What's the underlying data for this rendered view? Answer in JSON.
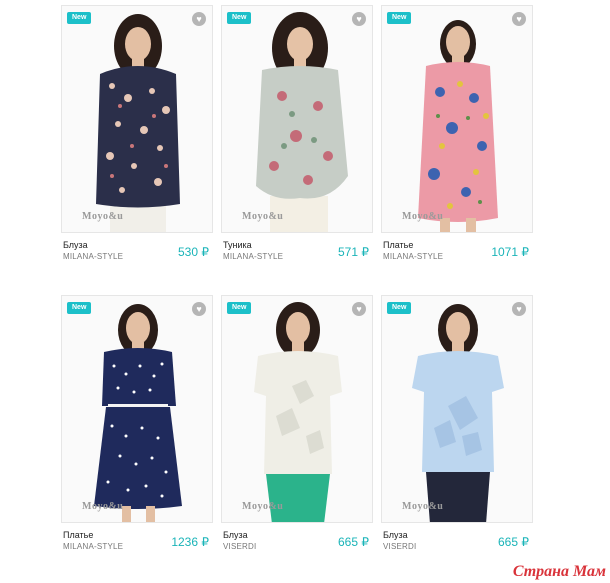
{
  "badge_label": "New",
  "favorite_icon": "heart-icon",
  "watermark_text": "Moyo&u",
  "site_logo": "Страна Мам",
  "colors": {
    "accent": "#1cc0c9",
    "price": "#1ab4b8",
    "logo": "#d9333a"
  },
  "products": [
    {
      "type": "Блуза",
      "brand": "MILANA-STYLE",
      "price": "530 ₽"
    },
    {
      "type": "Туника",
      "brand": "MILANA-STYLE",
      "price": "571 ₽"
    },
    {
      "type": "Платье",
      "brand": "MILANA-STYLE",
      "price": "1071 ₽"
    },
    {
      "type": "Платье",
      "brand": "MILANA-STYLE",
      "price": "1236 ₽"
    },
    {
      "type": "Блуза",
      "brand": "VISERDI",
      "price": "665 ₽"
    },
    {
      "type": "Блуза",
      "brand": "VISERDI",
      "price": "665 ₽"
    }
  ]
}
